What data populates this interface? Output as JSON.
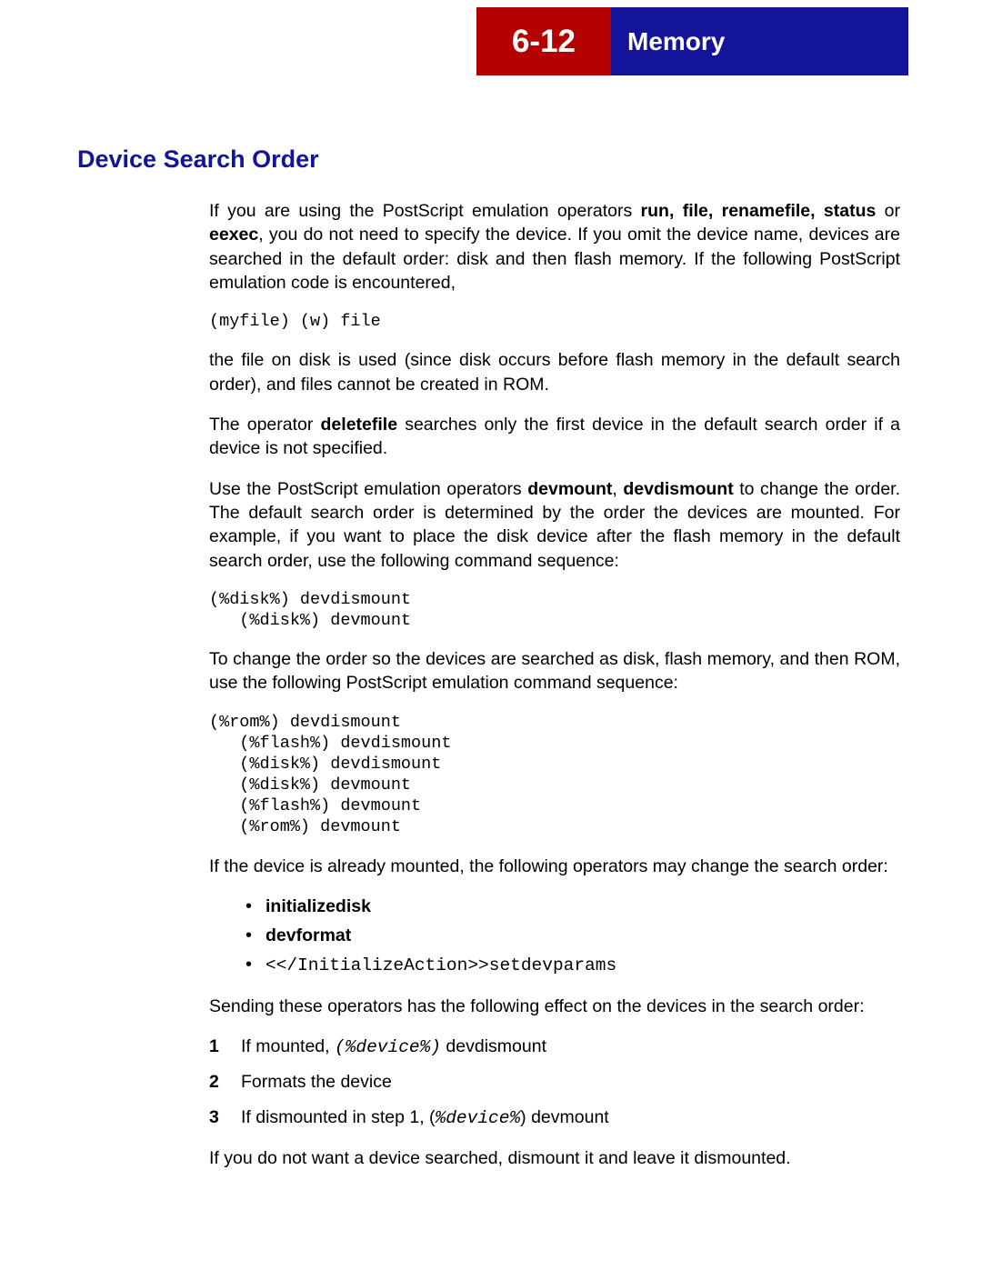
{
  "header": {
    "page_number": "6-12",
    "chapter_title": "Memory"
  },
  "section": {
    "title": "Device Search Order",
    "p1_a": "If you are using the PostScript emulation operators ",
    "p1_bold": "run, file, renamefile, status",
    "p1_b": " or ",
    "p1_bold2": "eexec",
    "p1_c": ", you do not need to specify the device. If you omit the device name, devices are searched in the default order: disk and then flash memory. If the following PostScript emulation code is encountered,",
    "code1": "(myfile) (w) file",
    "p2": "the file on disk is used (since disk occurs before flash memory in the default search order), and files cannot be created in ROM.",
    "p3_a": "The operator ",
    "p3_bold": "deletefile",
    "p3_b": " searches only the first device in the default search order if a device is not specified.",
    "p4_a": "Use the PostScript emulation operators ",
    "p4_bold1": "devmount",
    "p4_mid": ", ",
    "p4_bold2": "devdismount",
    "p4_b": " to change the order. The default search order is determined by the order the devices are mounted. For example, if you want to place the disk device after the flash memory in the default search order, use the following command sequence:",
    "code2": "(%disk%) devdismount\n   (%disk%) devmount",
    "p5": "To change the order so the devices are searched as disk, flash memory, and then ROM, use the following PostScript emulation command sequence:",
    "code3": "(%rom%) devdismount\n   (%flash%) devdismount\n   (%disk%) devdismount\n   (%disk%) devmount\n   (%flash%) devmount\n   (%rom%) devmount",
    "p6": "If the device is already mounted, the following operators may change the search order:",
    "bullets": {
      "b1": "initializedisk",
      "b2": "devformat",
      "b3": "<</InitializeAction>>setdevparams"
    },
    "p7": "Sending these operators has the following effect on the devices in the search order:",
    "steps": {
      "s1_a": "If mounted, ",
      "s1_code": "(%device%)",
      "s1_b": " devdismount",
      "s2": "Formats the device",
      "s3_a": "If dismounted in step 1, (",
      "s3_code": "%device%",
      "s3_b": ") devmount"
    },
    "p8": "If you do not want a device searched, dismount it and leave it dismounted."
  }
}
